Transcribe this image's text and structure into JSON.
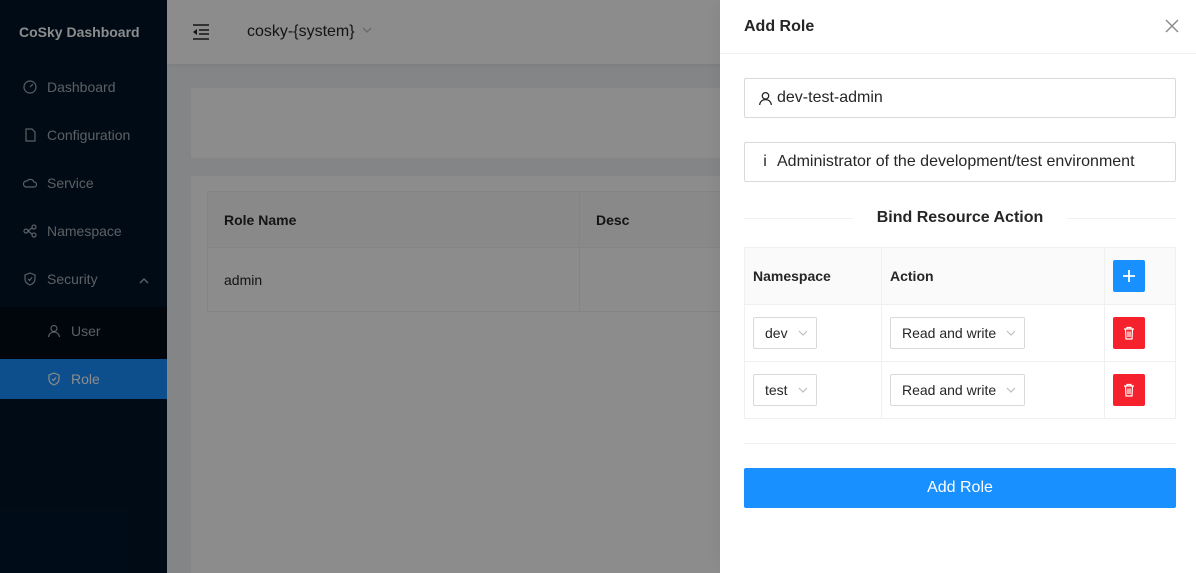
{
  "app": {
    "title": "CoSky Dashboard"
  },
  "sidebar": {
    "items": [
      {
        "label": "Dashboard",
        "icon": "dashboard-icon"
      },
      {
        "label": "Configuration",
        "icon": "file-icon"
      },
      {
        "label": "Service",
        "icon": "cloud-icon"
      },
      {
        "label": "Namespace",
        "icon": "cluster-icon"
      },
      {
        "label": "Security",
        "icon": "shield-icon",
        "expanded": true
      }
    ],
    "security_children": [
      {
        "label": "User",
        "icon": "user-icon"
      },
      {
        "label": "Role",
        "icon": "shield-icon",
        "selected": true
      }
    ]
  },
  "header": {
    "namespace": "cosky-{system}"
  },
  "roles_table": {
    "columns": [
      "Role Name",
      "Desc"
    ],
    "rows": [
      {
        "name": "admin",
        "desc": ""
      }
    ]
  },
  "drawer": {
    "title": "Add Role",
    "name_value": "dev-test-admin",
    "desc_value": "Administrator of the development/test environment",
    "section_title": "Bind Resource Action",
    "bind_columns": [
      "Namespace",
      "Action"
    ],
    "bind_rows": [
      {
        "namespace": "dev",
        "action": "Read and write"
      },
      {
        "namespace": "test",
        "action": "Read and write"
      }
    ],
    "submit_label": "Add Role"
  },
  "colors": {
    "primary": "#1890ff",
    "danger": "#f5222d",
    "sidebar": "#001529"
  }
}
